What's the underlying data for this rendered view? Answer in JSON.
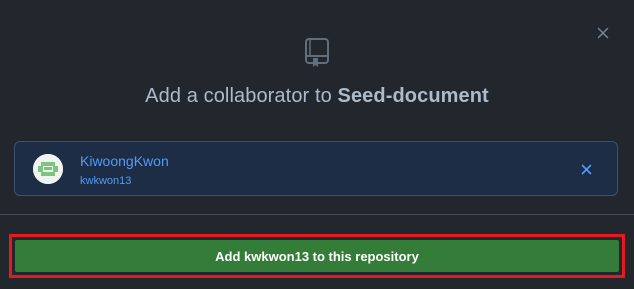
{
  "dialog": {
    "title_prefix": "Add a collaborator to ",
    "repo_name": "Seed-document",
    "close_icon": "close-icon",
    "repo_icon": "repo-icon"
  },
  "collaborator": {
    "name": "KiwoongKwon",
    "login": "kwkwon13",
    "avatar_icon": "identicon-avatar",
    "remove_icon": "remove-icon"
  },
  "action": {
    "add_label": "Add kwkwon13 to this repository"
  },
  "colors": {
    "background": "#22272e",
    "card": "#1d2d45",
    "link": "#539bf5",
    "button": "#347d39",
    "highlight": "#e5191f"
  }
}
